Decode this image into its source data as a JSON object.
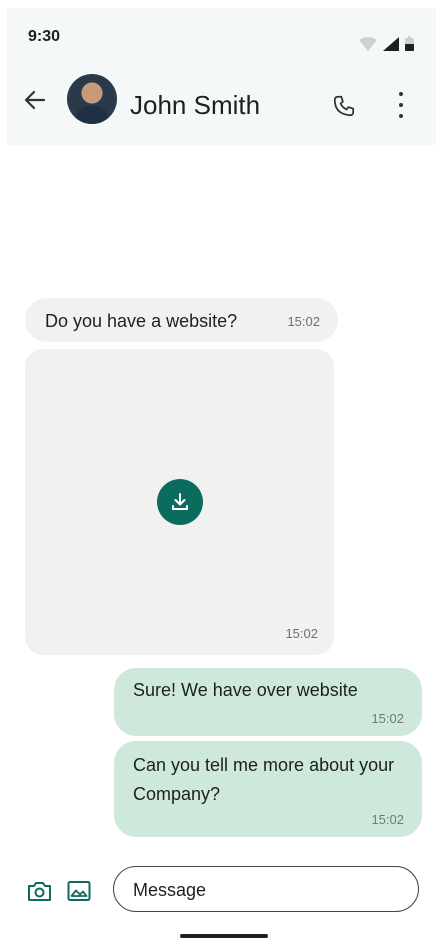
{
  "status_bar": {
    "time": "9:30"
  },
  "header": {
    "contact_name": "John Smith",
    "icons": [
      "back-arrow-icon",
      "avatar",
      "phone-icon",
      "more-vert-icon"
    ]
  },
  "messages": [
    {
      "direction": "incoming",
      "text": "Do you have a website?",
      "time": "15:02"
    },
    {
      "direction": "incoming",
      "type": "media-download",
      "time": "15:02"
    },
    {
      "direction": "outgoing",
      "text": "Sure! We have over website",
      "time": "15:02"
    },
    {
      "direction": "outgoing",
      "text": "Can you tell me more about your Company?",
      "time": "15:02"
    }
  ],
  "composer": {
    "placeholder": "Message"
  },
  "colors": {
    "accent": "#0b6b5c",
    "outgoing_bubble": "#cfe8dc",
    "incoming_bubble": "#f1f2f0",
    "header_bg": "#f4f8f9"
  }
}
